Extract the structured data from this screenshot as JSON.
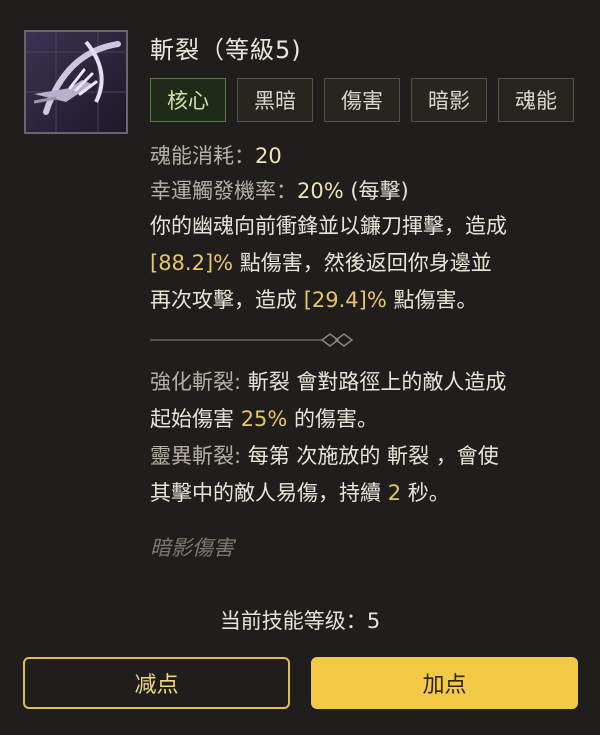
{
  "skill": {
    "title": "斬裂（等級5)",
    "icon": "scythe-hand-icon",
    "tags": [
      "核心",
      "黑暗",
      "傷害",
      "暗影",
      "魂能"
    ]
  },
  "stats": {
    "cost_label": "魂能消耗：",
    "cost_value": "20",
    "lucky_label": "幸運觸發機率：",
    "lucky_value": "20%",
    "lucky_suffix": " (每擊)"
  },
  "description": {
    "l1": "你的幽魂向前衝鋒並以鐮刀揮擊，造成",
    "dmg1": "[88.2]%",
    "l2": " 點傷害，然後返回你身邊並",
    "l3": "再次攻擊，造成 ",
    "dmg2": "[29.4]%",
    "l4": " 點傷害。"
  },
  "upgrades": {
    "u1_label": "強化斬裂:",
    "u1_a": " 斬裂 會對路徑上的敵人造成",
    "u1_b": "起始傷害 ",
    "u1_value": "25%",
    "u1_c": " 的傷害。",
    "u2_label": "靈異斬裂:",
    "u2_a": " 每第  次施放的 斬裂 ，會使",
    "u2_b": "其擊中的敵人易傷，持續 ",
    "u2_value": "2",
    "u2_c": " 秒。"
  },
  "damage_type": "暗影傷害",
  "level": {
    "label": "当前技能等级：",
    "value": "5"
  },
  "buttons": {
    "minus": "减点",
    "plus": "加点"
  },
  "colors": {
    "accent": "#f2ca45",
    "highlight": "#e9c46a",
    "core_tag": "#5a7a3e"
  }
}
